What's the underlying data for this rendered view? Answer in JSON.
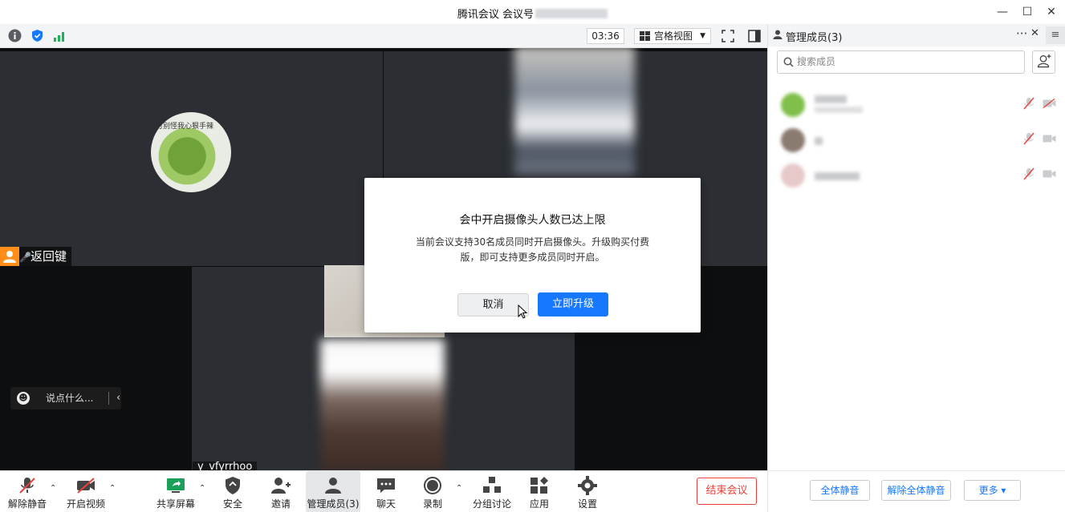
{
  "window": {
    "title": "腾讯会议 会议号",
    "minimize_label": "—",
    "maximize_label": "☐",
    "close_label": "✕"
  },
  "toolbar": {
    "timer": "03:36",
    "view_mode": "宫格视图",
    "fullscreen_label": "⛶"
  },
  "video": {
    "participant_name": "返回键",
    "avatar_caption": "可别怪我心狠手辣",
    "chat_placeholder": "说点什么...",
    "bottom_name": "y_vfyrrhoo"
  },
  "dialog": {
    "title": "会中开启摄像头人数已达上限",
    "body": "当前会议支持30名成员同时开启摄像头。升级购买付费版，即可支持更多成员同时开启。",
    "cancel_label": "取消",
    "upgrade_label": "立即升级"
  },
  "bottombar": {
    "items": [
      {
        "label": "解除静音"
      },
      {
        "label": "开启视频"
      },
      {
        "label": "共享屏幕"
      },
      {
        "label": "安全"
      },
      {
        "label": "邀请"
      },
      {
        "label": "管理成员(3)"
      },
      {
        "label": "聊天"
      },
      {
        "label": "录制"
      },
      {
        "label": "分组讨论"
      },
      {
        "label": "应用"
      },
      {
        "label": "设置"
      }
    ],
    "end_label": "结束会议"
  },
  "panel": {
    "title": "管理成员(3)",
    "more_label": "···",
    "close_label": "✕",
    "menu_label": "≡",
    "search_placeholder": "搜索成员",
    "mute_all_label": "全体静音",
    "unmute_all_label": "解除全体静音",
    "more_button_label": "更多 ▾"
  },
  "colors": {
    "accent": "#1677ff",
    "danger": "#e8413b",
    "badge": "#ff8d1a"
  }
}
